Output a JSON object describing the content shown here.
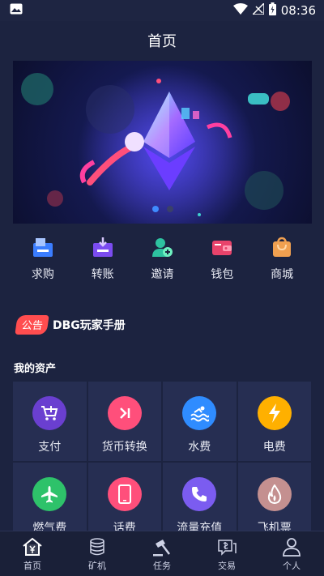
{
  "status": {
    "time": "08:36",
    "icons": [
      "image-icon",
      "wifi-icon",
      "signal-icon",
      "battery-icon"
    ]
  },
  "header": {
    "title": "首页"
  },
  "banner": {
    "slides": 2,
    "active_index": 0,
    "image": "ethereum-themed-illustration"
  },
  "quick_menu": [
    {
      "label": "求购",
      "icon": "buy-request-icon"
    },
    {
      "label": "转账",
      "icon": "transfer-icon"
    },
    {
      "label": "邀请",
      "icon": "invite-icon"
    },
    {
      "label": "钱包",
      "icon": "wallet-icon"
    },
    {
      "label": "商城",
      "icon": "mall-icon"
    }
  ],
  "notice": {
    "badge": "公告",
    "text": "DBG玩家手册"
  },
  "assets": {
    "title": "我的资产",
    "items": [
      {
        "label": "支付",
        "icon": "cart-plus-icon",
        "color": "#6a3fd0"
      },
      {
        "label": "货币转换",
        "icon": "exchange-icon",
        "color": "#ff4f7b"
      },
      {
        "label": "水费",
        "icon": "water-icon",
        "color": "#2f8cff"
      },
      {
        "label": "电费",
        "icon": "lightning-icon",
        "color": "#ffb000"
      },
      {
        "label": "燃气费",
        "icon": "airplane-icon",
        "color": "#2ec26a"
      },
      {
        "label": "话费",
        "icon": "phone-icon",
        "color": "#ff4f7b"
      },
      {
        "label": "流量充值",
        "icon": "call-icon",
        "color": "#7b5cf0"
      },
      {
        "label": "飞机票",
        "icon": "flame-icon",
        "color": "#c49090"
      }
    ]
  },
  "tabbar": [
    {
      "label": "首页",
      "icon": "home-yen-icon",
      "active": true
    },
    {
      "label": "矿机",
      "icon": "miner-icon",
      "active": false
    },
    {
      "label": "任务",
      "icon": "gavel-icon",
      "active": false
    },
    {
      "label": "交易",
      "icon": "trade-icon",
      "active": false
    },
    {
      "label": "个人",
      "icon": "user-icon",
      "active": false
    }
  ],
  "colors": {
    "background": "#1c2340",
    "cell": "#262e52",
    "accent": "#3f8bff",
    "notice_badge": "#ff4d4f"
  }
}
